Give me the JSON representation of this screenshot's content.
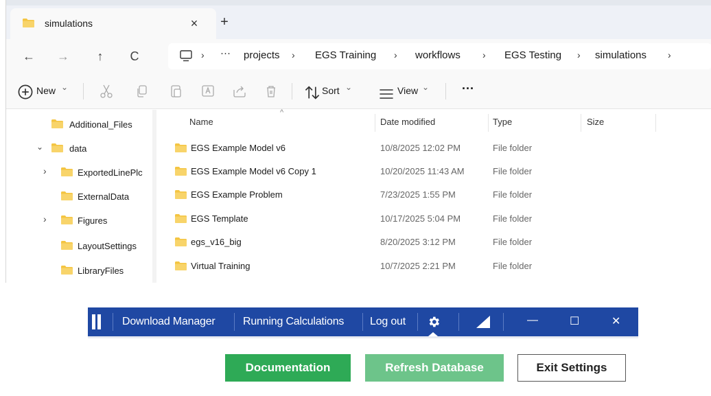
{
  "window": {
    "tab_title": "simulations",
    "tab_close": "×",
    "new_tab": "+"
  },
  "navigation": {
    "back": "←",
    "forward": "→",
    "up": "↑",
    "refresh": "C",
    "breadcrumb": [
      "projects",
      "EGS Training",
      "workflows",
      "EGS Testing",
      "simulations"
    ],
    "overflow": "···",
    "separator": "›"
  },
  "toolbar": {
    "new_label": "New",
    "sort_label": "Sort",
    "view_label": "View",
    "more_label": "···",
    "chevron": "⌄"
  },
  "nav_pane": {
    "items": [
      {
        "label": "Additional_Files",
        "chevron": ""
      },
      {
        "label": "data",
        "chevron": "⌄"
      },
      {
        "label": "ExportedLinePlc",
        "chevron": "›"
      },
      {
        "label": "ExternalData",
        "chevron": ""
      },
      {
        "label": "Figures",
        "chevron": "›"
      },
      {
        "label": "LayoutSettings",
        "chevron": ""
      },
      {
        "label": "LibraryFiles",
        "chevron": ""
      }
    ]
  },
  "file_list": {
    "columns": {
      "name": "Name",
      "date": "Date modified",
      "type": "Type",
      "size": "Size"
    },
    "sort_indicator": "^",
    "rows": [
      {
        "name": "EGS Example Model v6",
        "date": "10/8/2025 12:02 PM",
        "type": "File folder"
      },
      {
        "name": "EGS Example Model v6 Copy 1",
        "date": "10/20/2025 11:43 AM",
        "type": "File folder"
      },
      {
        "name": "EGS Example Problem",
        "date": "7/23/2025 1:55 PM",
        "type": "File folder"
      },
      {
        "name": "EGS Template",
        "date": "10/17/2025 5:04 PM",
        "type": "File folder"
      },
      {
        "name": "egs_v16_big",
        "date": "8/20/2025 3:12 PM",
        "type": "File folder"
      },
      {
        "name": "Virtual Training",
        "date": "10/7/2025 2:21 PM",
        "type": "File folder"
      }
    ]
  },
  "appbar": {
    "download_manager": "Download Manager",
    "running_calculations": "Running Calculations",
    "log_out": "Log out",
    "minimize": "—",
    "maximize": "☐",
    "close": "✕"
  },
  "buttons": {
    "documentation": "Documentation",
    "refresh_database": "Refresh Database",
    "exit_settings": "Exit Settings"
  },
  "colors": {
    "appbar_bg": "#1f48a3",
    "doc_button": "#2eaa56",
    "refresh_button": "#6dc48a",
    "folder": "#f4c542"
  }
}
